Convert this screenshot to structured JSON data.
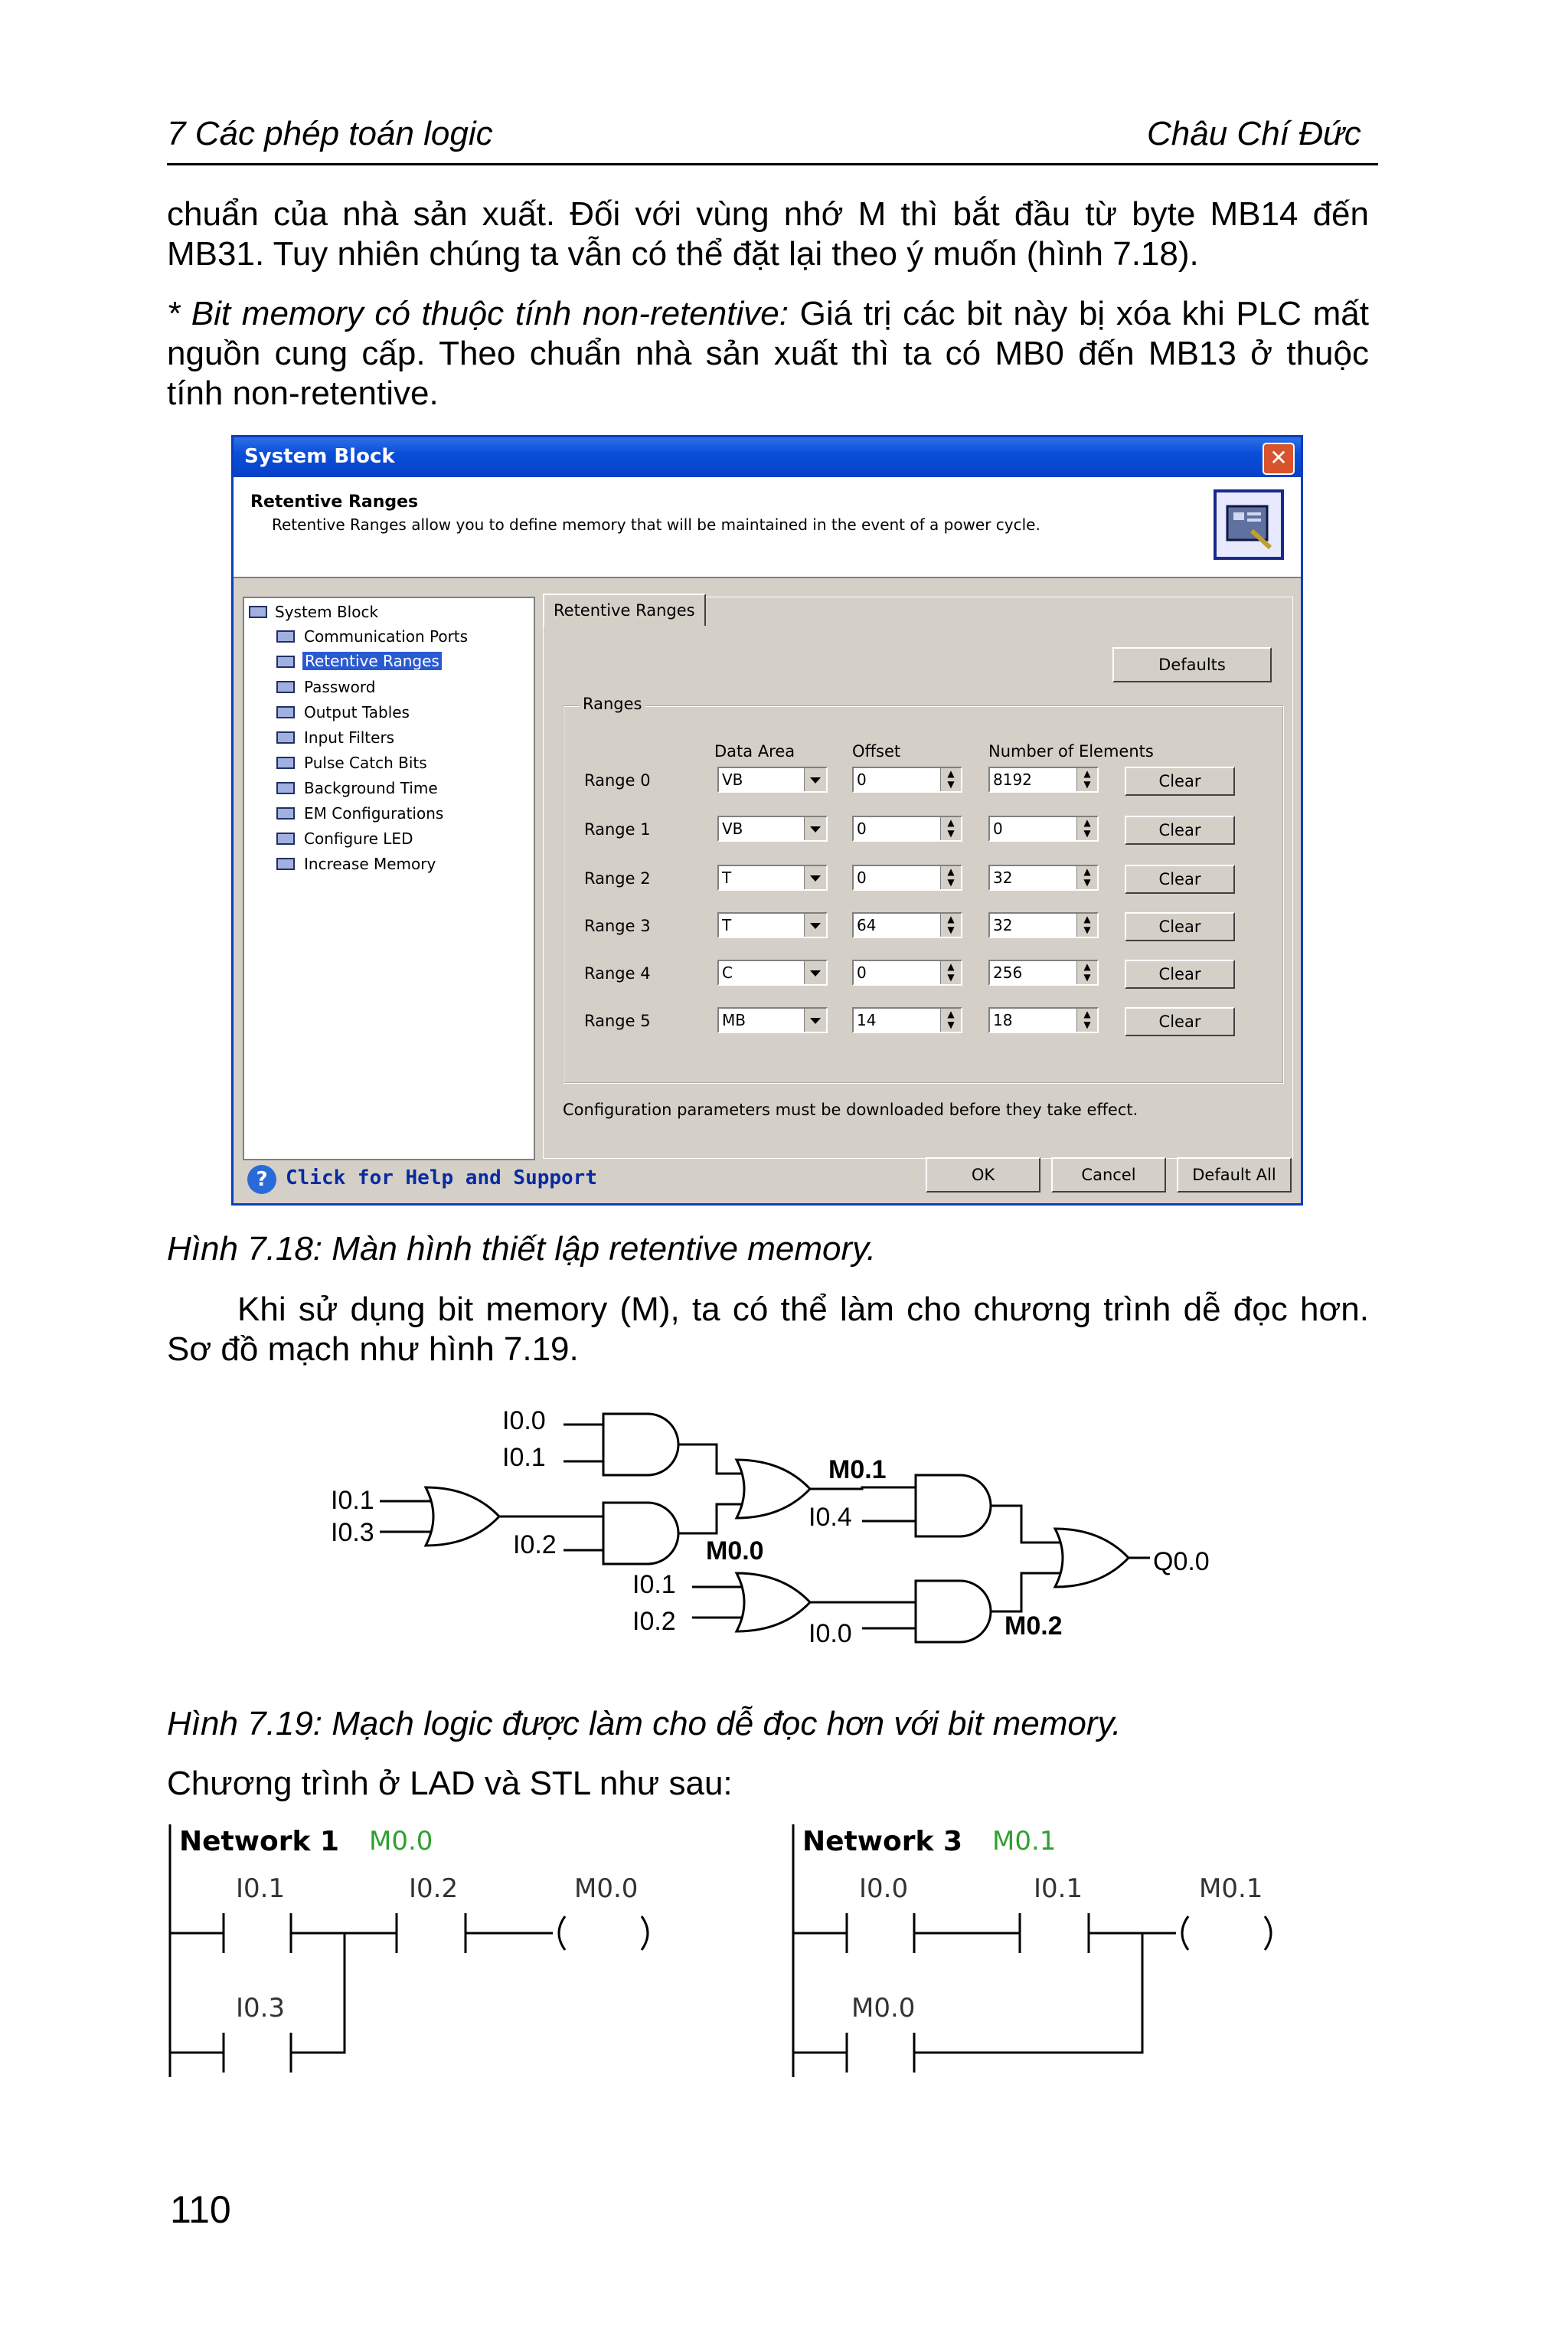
{
  "header": {
    "chapter": "7   Các phép toán logic",
    "author": "Châu Chí Đức"
  },
  "para1": [
    "chuẩn của nhà sản xuất. Đối với vùng nhớ M thì bắt đầu từ byte MB14 đến",
    "MB31. Tuy nhiên chúng ta vẫn có thể đặt lại theo ý muốn (hình 7.18)."
  ],
  "para2": {
    "italic": "* Bit memory có thuộc tính non-retentive:",
    "rest1": " Giá trị các bit này bị xóa khi PLC mất",
    "line2": "nguồn cung cấp. Theo chuẩn nhà sản xuất thì ta có MB0 đến MB13 ở thuộc",
    "line3": "tính non-retentive."
  },
  "dialog": {
    "title": "System Block",
    "close": "✕",
    "heading": "Retentive Ranges",
    "description": "Retentive Ranges allow you to define memory that will be maintained in the event of a power cycle.",
    "tree": [
      "System Block",
      "Communication Ports",
      "Retentive Ranges",
      "Password",
      "Output Tables",
      "Input Filters",
      "Pulse Catch Bits",
      "Background Time",
      "EM Configurations",
      "Configure LED",
      "Increase Memory"
    ],
    "tab": "Retentive Ranges",
    "defaults_button": "Defaults",
    "group_label": "Ranges",
    "col_data_area": "Data Area",
    "col_offset": "Offset",
    "col_elements": "Number of Elements",
    "ranges": [
      {
        "label": "Range 0",
        "area": "VB",
        "offset": "0",
        "elements": "8192",
        "clear": "Clear"
      },
      {
        "label": "Range 1",
        "area": "VB",
        "offset": "0",
        "elements": "0",
        "clear": "Clear"
      },
      {
        "label": "Range 2",
        "area": "T",
        "offset": "0",
        "elements": "32",
        "clear": "Clear"
      },
      {
        "label": "Range 3",
        "area": "T",
        "offset": "64",
        "elements": "32",
        "clear": "Clear"
      },
      {
        "label": "Range 4",
        "area": "C",
        "offset": "0",
        "elements": "256",
        "clear": "Clear"
      },
      {
        "label": "Range 5",
        "area": "MB",
        "offset": "14",
        "elements": "18",
        "clear": "Clear"
      }
    ],
    "note": "Configuration parameters must be downloaded before they take effect.",
    "help": "Click for Help and Support",
    "help_icon": "?",
    "ok": "OK",
    "cancel": "Cancel",
    "default_all": "Default All"
  },
  "caption1": "Hình 7.18: Màn hình thiết lập retentive memory.",
  "para3": [
    "Khi sử dụng bit memory (M), ta có thể làm cho chương trình dễ đọc hơn.",
    "Sơ đồ mạch như hình 7.19."
  ],
  "logic": {
    "labels": [
      "I0.0",
      "I0.1",
      "I0.1",
      "I0.3",
      "I0.2",
      "M0.1",
      "I0.4",
      "M0.0",
      "I0.1",
      "I0.2",
      "I0.0",
      "M0.2",
      "Q0.0"
    ]
  },
  "caption2": "Hình 7.19: Mạch logic được làm cho dễ đọc hơn với bit memory.",
  "para4": "Chương trình ở LAD và STL như sau:",
  "ladder": [
    {
      "network": "Network 1",
      "comment": "M0.0",
      "c1": "I0.1",
      "c2": "I0.2",
      "coil": "M0.0",
      "c3": "I0.3"
    },
    {
      "network": "Network 3",
      "comment": "M0.1",
      "c1": "I0.0",
      "c2": "I0.1",
      "coil": "M0.1",
      "c3": "M0.0"
    }
  ],
  "page_number": "110"
}
